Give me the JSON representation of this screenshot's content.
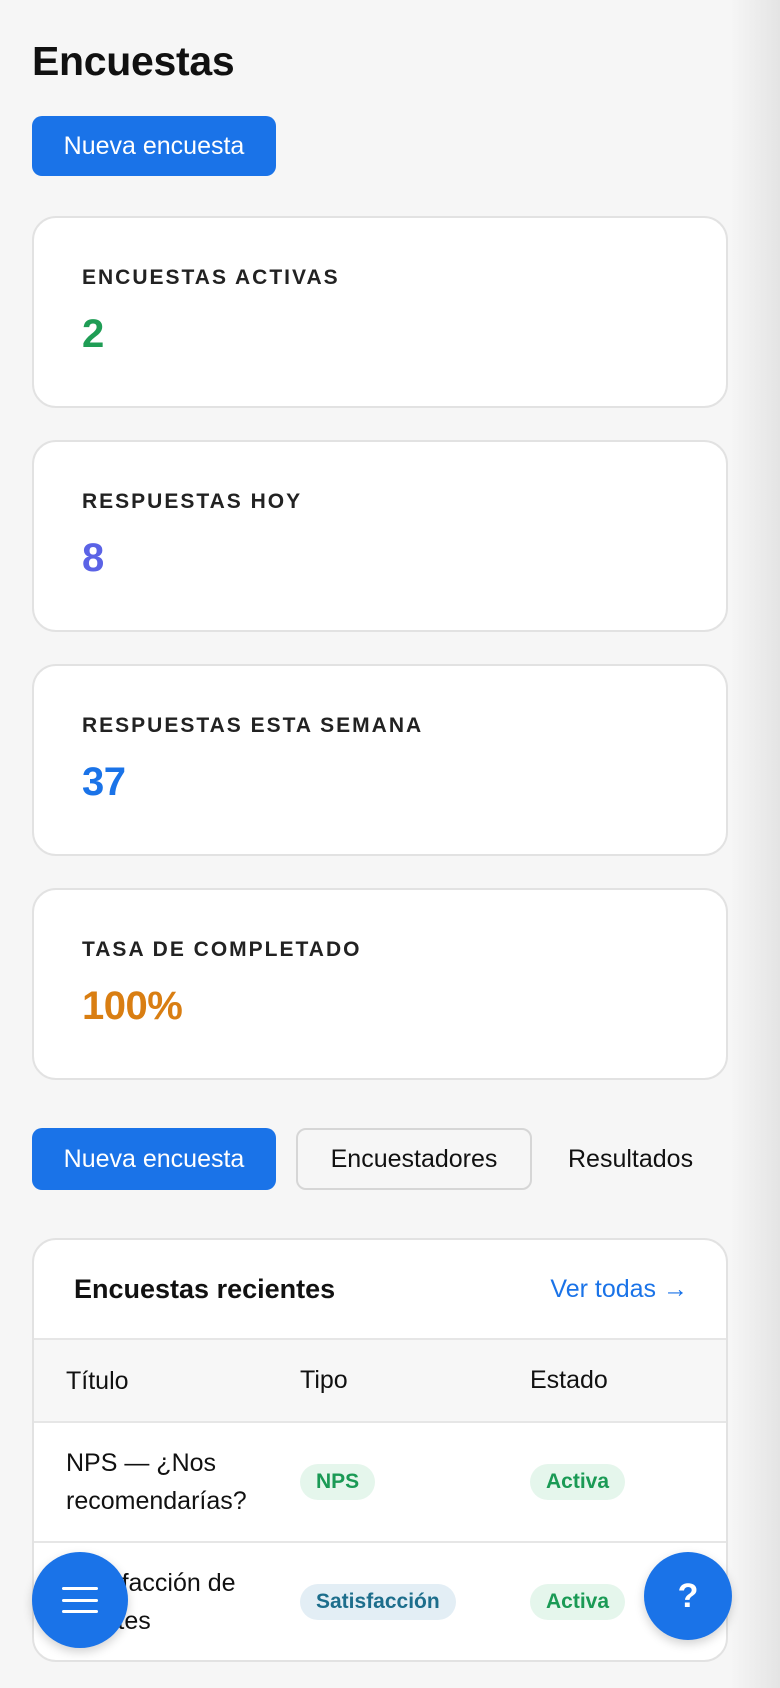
{
  "page": {
    "title": "Encuestas"
  },
  "header": {
    "new_survey_label": "Nueva encuesta"
  },
  "stats": [
    {
      "label": "ENCUESTAS ACTIVAS",
      "value": "2",
      "color": "#1f9d55"
    },
    {
      "label": "RESPUESTAS HOY",
      "value": "8",
      "color": "#5b63e6"
    },
    {
      "label": "RESPUESTAS ESTA SEMANA",
      "value": "37",
      "color": "#1a73e8"
    },
    {
      "label": "TASA DE COMPLETADO",
      "value": "100%",
      "color": "#d97e12"
    }
  ],
  "tabs": [
    {
      "label": "Nueva encuesta"
    },
    {
      "label": "Encuestadores"
    },
    {
      "label": "Resultados"
    }
  ],
  "recent": {
    "title": "Encuestas recientes",
    "see_all": "Ver todas →",
    "columns": [
      "Título",
      "Tipo",
      "Estado"
    ],
    "rows": [
      {
        "title": "NPS — ¿Nos recomendarías?",
        "type": "NPS",
        "status": "Activa"
      },
      {
        "title": "Satisfacción de clientes",
        "type": "Satisfacción",
        "status": "Activa"
      }
    ]
  },
  "fab": {
    "menu_icon": "menu-icon",
    "help_label": "?"
  },
  "colors": {
    "accent": "#1a73e8",
    "background": "#f6f6f6"
  }
}
